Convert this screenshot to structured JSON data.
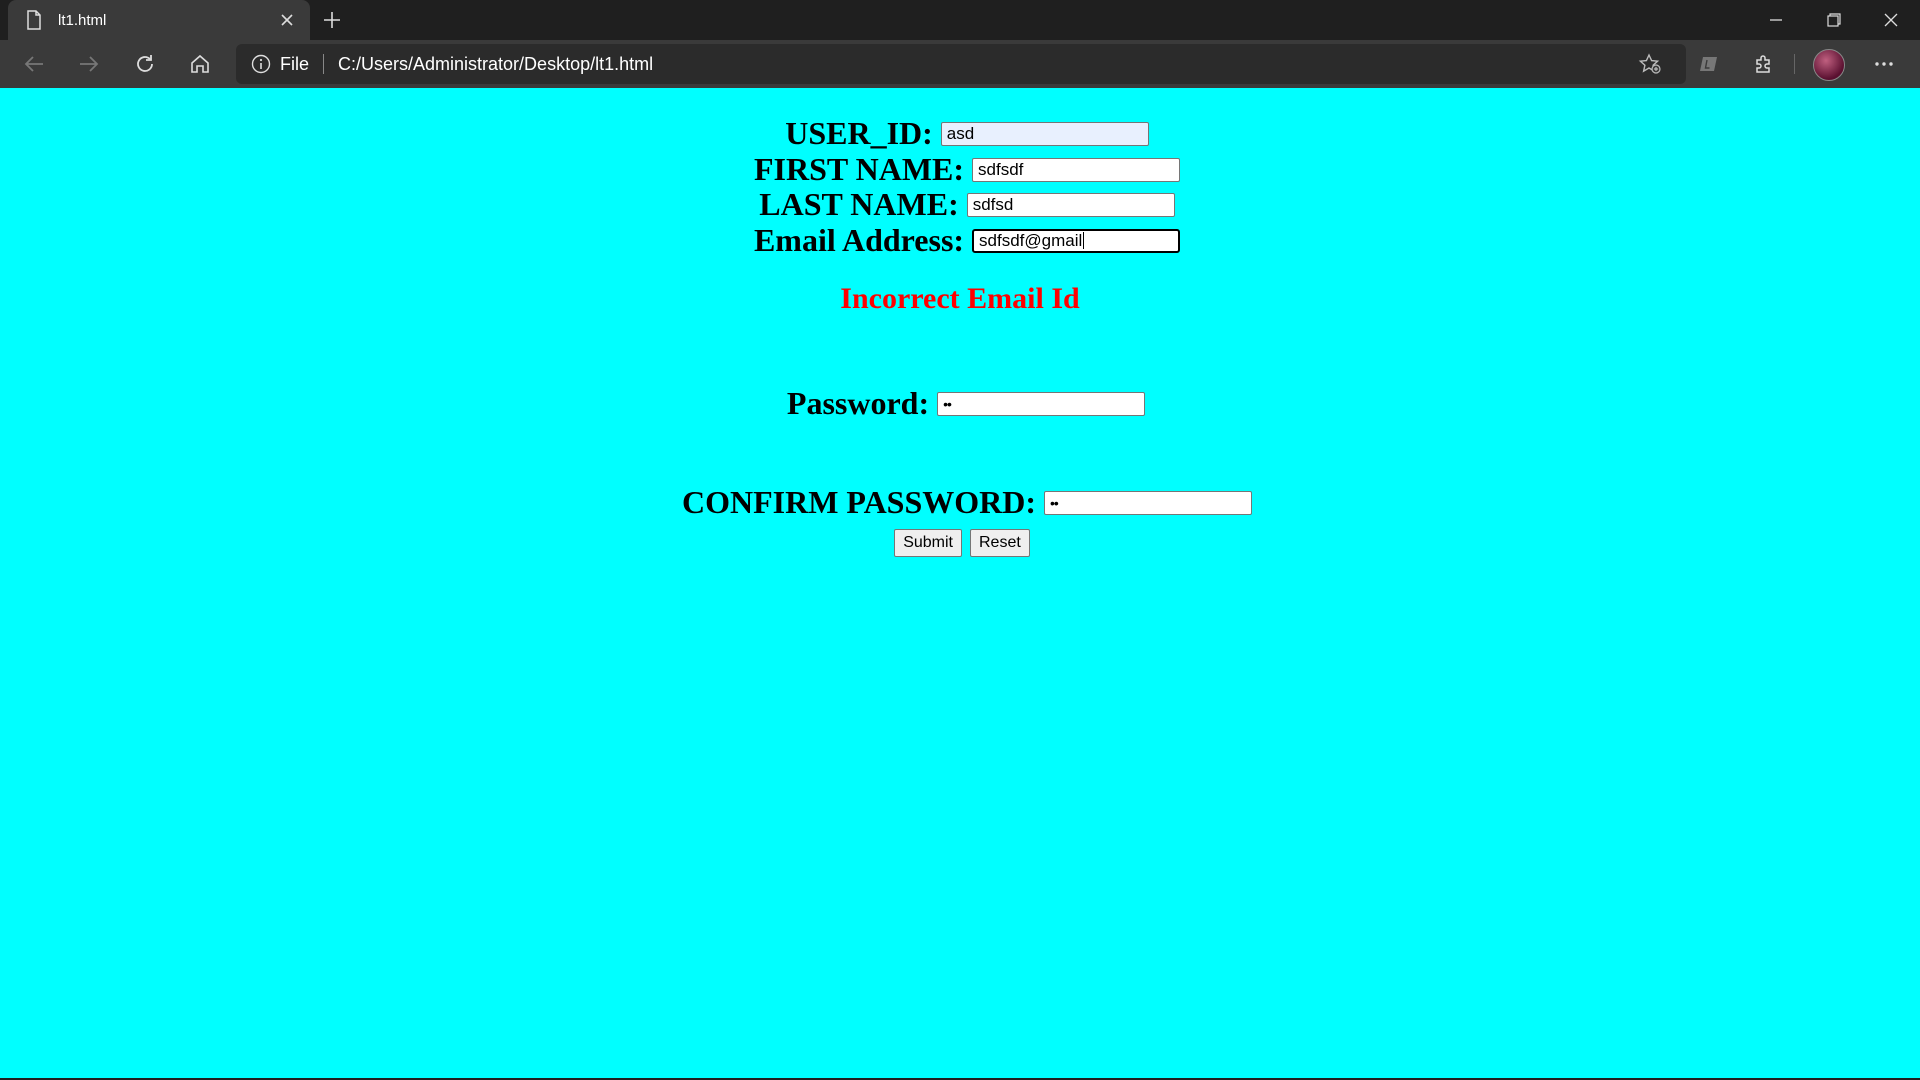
{
  "browser": {
    "tab_title": "lt1.html",
    "scheme_label": "File",
    "url": "C:/Users/Administrator/Desktop/lt1.html"
  },
  "form": {
    "user_id": {
      "label": "USER_ID:",
      "value": "asd"
    },
    "first_name": {
      "label": "FIRST NAME:",
      "value": "sdfsdf"
    },
    "last_name": {
      "label": "LAST NAME:",
      "value": "sdfsd"
    },
    "email": {
      "label": "Email Address:",
      "value": "sdfsdf@gmail"
    },
    "error_message": "Incorrect Email Id",
    "password": {
      "label": "Password:",
      "value": "••"
    },
    "confirm_password": {
      "label": "CONFIRM PASSWORD:",
      "value": "••"
    },
    "submit_label": "Submit",
    "reset_label": "Reset"
  },
  "colors": {
    "page_background": "#00ffff",
    "error_text": "#ff0000"
  }
}
